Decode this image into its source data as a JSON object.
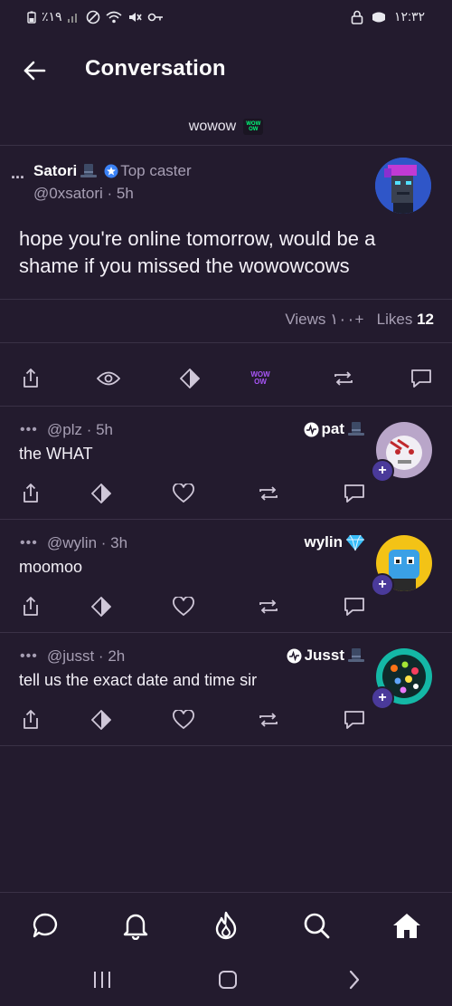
{
  "status_bar": {
    "battery": "٪۱۹",
    "time": "۱۲:۳۲"
  },
  "header": {
    "title": "Conversation"
  },
  "channel": {
    "name": "wowow",
    "badge_line1": "WOW",
    "badge_line2": "OW"
  },
  "main_cast": {
    "author": "Satori",
    "top_caster_label": "Top caster",
    "handle_time": "@0xsatori · 5h",
    "text": "hope you're online tomorrow, would be a shame if you missed the wowowcows",
    "views_label": "Views",
    "views_value": "۱۰۰+",
    "likes_label": "Likes",
    "likes_value": "12",
    "wow_icon_line1": "WOW",
    "wow_icon_line2": "OW"
  },
  "replies": [
    {
      "handle_time": "@plz · 5h",
      "name": "pat",
      "text": "the WHAT"
    },
    {
      "handle_time": "@wylin · 3h",
      "name": "wylin",
      "text": "moomoo"
    },
    {
      "handle_time": "@jusst · 2h",
      "name": "Jusst",
      "text": "tell us the exact date and time sir"
    }
  ],
  "colors": {
    "background": "#231b2e",
    "accent_purple": "#a855f7",
    "muted_text": "#a79fb4",
    "divider": "#3a3146"
  },
  "bottom_nav": {
    "items": [
      "chat-icon",
      "bell-icon",
      "flame-icon",
      "search-icon",
      "home-icon"
    ],
    "active": "home-icon"
  }
}
